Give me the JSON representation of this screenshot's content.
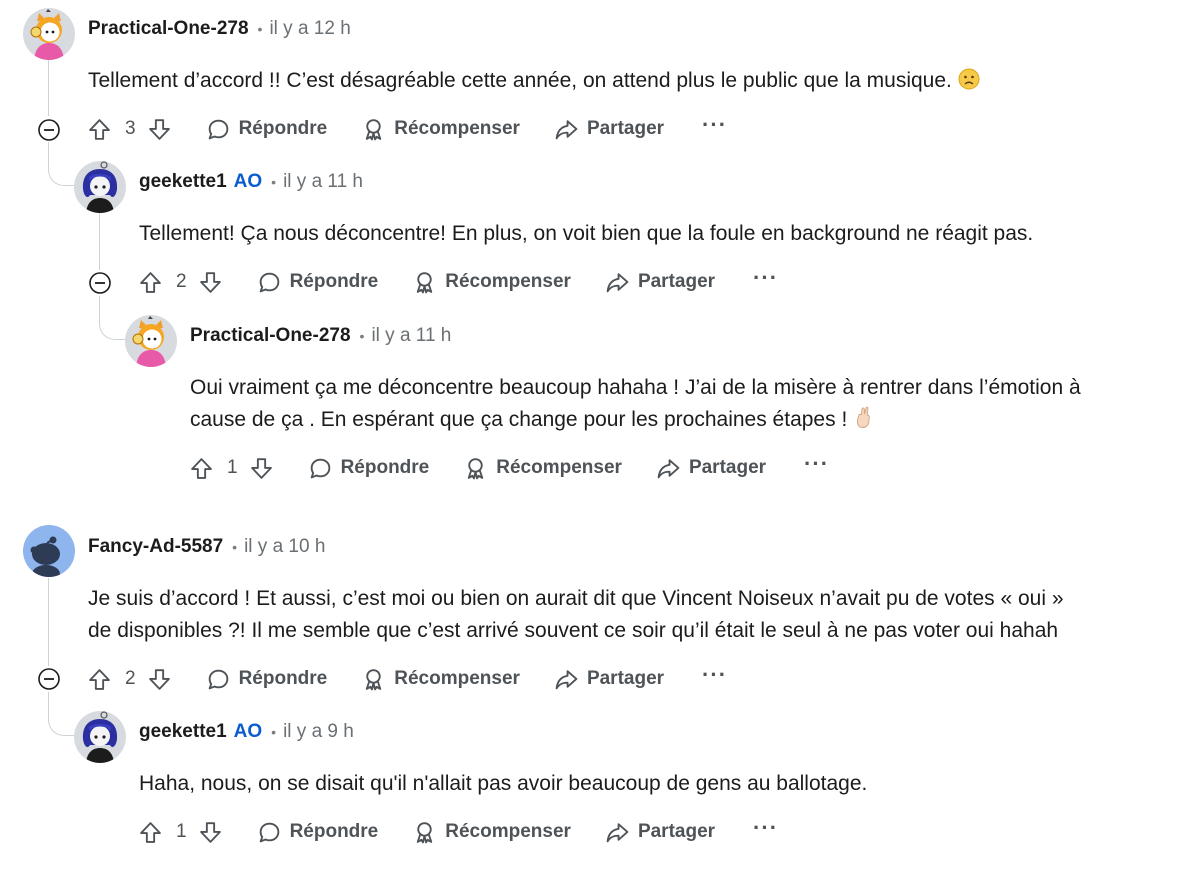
{
  "comments": [
    {
      "username": "Practical-One-278",
      "time": "il y a 12 h",
      "text": "Tellement d’accord !! C’est désagréable cette année, on attend plus le public que la musique.",
      "votes": "3",
      "avatar_icon": "snoo-avatar-cat-hood-icon"
    },
    {
      "username": "geekette1",
      "op_badge": "AO",
      "time": "il y a 11 h",
      "text": "Tellement! Ça nous déconcentre! En plus, on voit bien que la foule en background ne réagit pas.",
      "votes": "2",
      "avatar_icon": "snoo-avatar-blue-hair-icon"
    },
    {
      "username": "Practical-One-278",
      "time": "il y a 11 h",
      "text_line1": "Oui vraiment ça me déconcentre beaucoup hahaha ! J’ai de la misère à rentrer dans l’émotion à",
      "text_line2": "cause de ça . En espérant que ça change pour les prochaines étapes !",
      "votes": "1",
      "avatar_icon": "snoo-avatar-cat-hood-icon"
    },
    {
      "username": "Fancy-Ad-5587",
      "time": "il y a 10 h",
      "text_line1": "Je suis d’accord ! Et aussi, c’est moi ou bien on aurait dit que Vincent Noiseux n’avait pu de votes « oui »",
      "text_line2": "de disponibles ?! Il me semble que c’est arrivé souvent ce soir qu’il était le seul à ne pas voter oui hahah",
      "votes": "2",
      "avatar_icon": "snoo-default-avatar-icon"
    },
    {
      "username": "geekette1",
      "op_badge": "AO",
      "time": "il y a 9 h",
      "text": "Haha, nous, on se disait qu'il n'allait pas avoir beaucoup de gens au ballotage.",
      "votes": "1",
      "avatar_icon": "snoo-avatar-blue-hair-icon"
    }
  ],
  "actions": {
    "reply": "Répondre",
    "award": "Récompenser",
    "share": "Partager",
    "more": "···"
  },
  "colors": {
    "text": "#1c1c1c",
    "meta": "#6a6f73",
    "op_badge": "#0a5ccf",
    "thread_line": "#cfd3d6",
    "action": "#4e5358"
  }
}
